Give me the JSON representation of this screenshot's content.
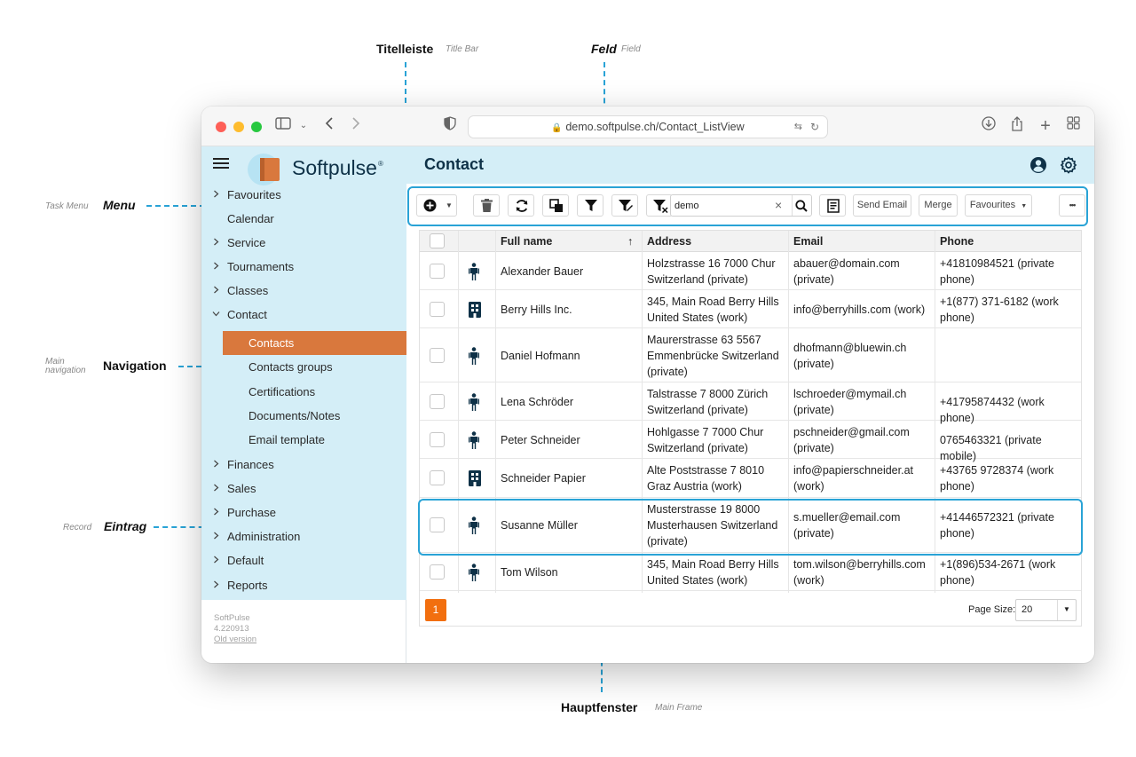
{
  "annotations": {
    "title_bar": {
      "main": "Titelleiste",
      "sub": "Title Bar"
    },
    "field": {
      "main": "Feld",
      "sub": "Field"
    },
    "task_menu": {
      "main": "Menu",
      "sub": "Task Menu"
    },
    "navigation": {
      "main": "Navigation",
      "sub_line1": "Main",
      "sub_line2": "navigation"
    },
    "record": {
      "main": "Eintrag",
      "sub": "Record"
    },
    "main_frame": {
      "main": "Hauptfenster",
      "sub": "Main Frame"
    }
  },
  "browser": {
    "url": "demo.softpulse.ch/Contact_ListView"
  },
  "app": {
    "brand": "Softpulse",
    "brand_mark": "®",
    "page_title": "Contact",
    "accent_color": "#d9783d",
    "header_bg": "#d4eef7"
  },
  "sidebar": {
    "items": [
      {
        "label": "Favourites",
        "chevron": ">"
      },
      {
        "label": "Calendar",
        "chevron": ""
      },
      {
        "label": "Service",
        "chevron": ">"
      },
      {
        "label": "Tournaments",
        "chevron": ">"
      },
      {
        "label": "Classes",
        "chevron": ">"
      },
      {
        "label": "Contact",
        "chevron": "v"
      }
    ],
    "sub_items": [
      {
        "label": "Contacts",
        "active": true
      },
      {
        "label": "Contacts groups"
      },
      {
        "label": "Certifications"
      },
      {
        "label": "Documents/Notes"
      },
      {
        "label": "Email template"
      }
    ],
    "items_after": [
      {
        "label": "Finances",
        "chevron": ">"
      },
      {
        "label": "Sales",
        "chevron": ">"
      },
      {
        "label": "Purchase",
        "chevron": ">"
      },
      {
        "label": "Administration",
        "chevron": ">"
      },
      {
        "label": "Default",
        "chevron": ">"
      },
      {
        "label": "Reports",
        "chevron": ">"
      }
    ],
    "version": {
      "name": "SoftPulse",
      "number": "4.220913",
      "old_link": "Old version"
    }
  },
  "toolbar": {
    "search_value": "demo",
    "send_email": "Send Email",
    "merge": "Merge",
    "favourites": "Favourites",
    "more": "•••"
  },
  "table": {
    "columns": [
      "Full name",
      "Address",
      "Email",
      "Phone"
    ],
    "sort_indicator": "↑",
    "rows": [
      {
        "type": "person",
        "name": "Alexander Bauer",
        "address": [
          "Holzstrasse 16 7000 Chur",
          "Switzerland (private)"
        ],
        "email": [
          "abauer@domain.com",
          "(private)"
        ],
        "phone": [
          "+41810984521 (private",
          "phone)"
        ]
      },
      {
        "type": "company",
        "name": "Berry Hills Inc.",
        "address": [
          "345, Main Road Berry Hills",
          "United States (work)"
        ],
        "email": [
          "info@berryhills.com (work)"
        ],
        "phone": [
          "+1(877) 371-6182 (work",
          "phone)"
        ]
      },
      {
        "type": "person",
        "name": "Daniel Hofmann",
        "address": [
          "Maurerstrasse 63 5567",
          "Emmenbrücke Switzerland",
          "(private)"
        ],
        "email": [
          "dhofmann@bluewin.ch",
          "(private)"
        ],
        "phone": []
      },
      {
        "type": "person",
        "name": "Lena Schröder",
        "address": [
          "Talstrasse 7 8000 Zürich",
          "Switzerland (private)"
        ],
        "email": [
          "lschroeder@mymail.ch",
          "(private)"
        ],
        "phone": [
          "+41795874432 (work phone)"
        ]
      },
      {
        "type": "person",
        "name": "Peter Schneider",
        "address": [
          "Hohlgasse 7 7000 Chur",
          "Switzerland (private)"
        ],
        "email": [
          "pschneider@gmail.com",
          "(private)"
        ],
        "phone": [
          "0765463321 (private mobile)"
        ]
      },
      {
        "type": "company",
        "name": "Schneider Papier",
        "address": [
          "Alte Poststrasse 7 8010",
          "Graz Austria (work)"
        ],
        "email": [
          "info@papierschneider.at",
          "(work)"
        ],
        "phone": [
          "+43765 9728374 (work",
          "phone)"
        ]
      },
      {
        "type": "person",
        "name": "Susanne Müller",
        "address": [
          "Musterstrasse 19 8000",
          "Musterhausen Switzerland",
          "(private)"
        ],
        "email": [
          "s.mueller@email.com",
          "(private)"
        ],
        "phone": [
          "+41446572321 (private",
          "phone)"
        ]
      },
      {
        "type": "person",
        "name": "Tom Wilson",
        "address": [
          "345, Main Road Berry Hills",
          "United States (work)"
        ],
        "email": [
          "tom.wilson@berryhills.com",
          "(work)"
        ],
        "phone": [
          "+1(896)534-2671 (work",
          "phone)"
        ]
      }
    ]
  },
  "pagination": {
    "current_page": "1",
    "page_size_label": "Page Size:",
    "page_size_value": "20"
  }
}
